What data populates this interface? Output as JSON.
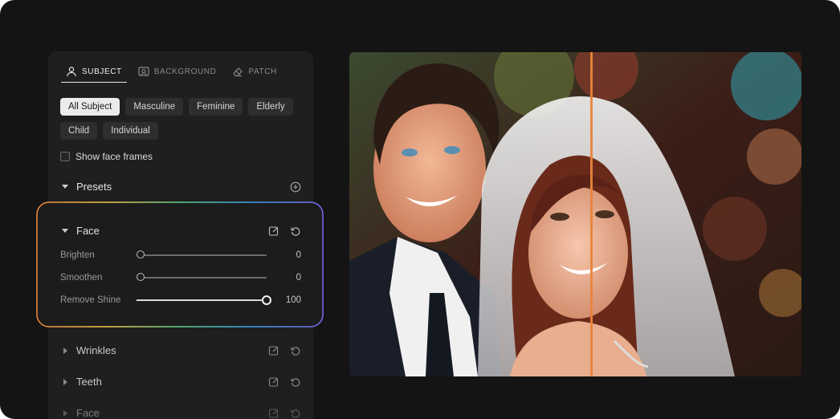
{
  "tabs": [
    {
      "label": "SUBJECT",
      "icon": "person-icon",
      "active": true
    },
    {
      "label": "BACKGROUND",
      "icon": "image-frame-icon",
      "active": false
    },
    {
      "label": "PATCH",
      "icon": "eraser-icon",
      "active": false
    }
  ],
  "subject_filters": [
    "All Subject",
    "Masculine",
    "Feminine",
    "Elderly",
    "Child",
    "Individual"
  ],
  "active_filter": "All Subject",
  "show_face_frames": {
    "label": "Show face frames",
    "checked": false
  },
  "presets": {
    "label": "Presets",
    "add_icon": "plus-circle-icon"
  },
  "face": {
    "label": "Face",
    "sliders": [
      {
        "label": "Brighten",
        "value": "0",
        "level": 0
      },
      {
        "label": "Smoothen",
        "value": "0",
        "level": 0
      },
      {
        "label": "Remove Shine",
        "value": "100",
        "level": 1
      }
    ]
  },
  "collapsed_sections": [
    {
      "label": "Wrinkles"
    },
    {
      "label": "Teeth"
    },
    {
      "label": "Face"
    }
  ],
  "colors": {
    "frame_bg": "#141414",
    "panel_bg": "#1f1f1f",
    "accent_gradient": [
      "#7a6cf0",
      "#3fa0f0",
      "#5fd08a",
      "#f2c94c",
      "#f2994a",
      "#eb5757"
    ]
  }
}
